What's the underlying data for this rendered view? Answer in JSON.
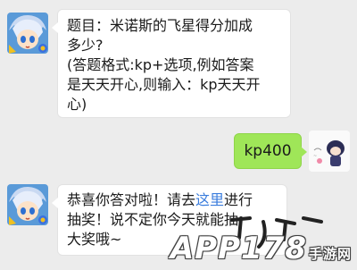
{
  "messages": [
    {
      "side": "left",
      "lines": [
        "题目：米诺斯的飞星得分加成",
        "多少?",
        "(答题格式:kp+选项,例如答案",
        "是天天开心,则输入：kp天天开",
        "心)"
      ]
    },
    {
      "side": "right",
      "text": "kp400"
    },
    {
      "side": "left",
      "line1": "恭喜你答对啦！请去",
      "link": "这里",
      "line1_tail": "进行",
      "line2": "抽奖！说不定你今天就能抽",
      "line3": "大奖哦~"
    }
  ],
  "watermark": {
    "main": "APP178",
    "sub": "手游网"
  },
  "colors": {
    "background": "#ececec",
    "bubble_left": "#ffffff",
    "bubble_right": "#9fe658",
    "link": "#3b7ddd"
  },
  "icons": {
    "bot_avatar": "anime-character-avatar",
    "user_avatar": "chibi-character-avatar"
  }
}
